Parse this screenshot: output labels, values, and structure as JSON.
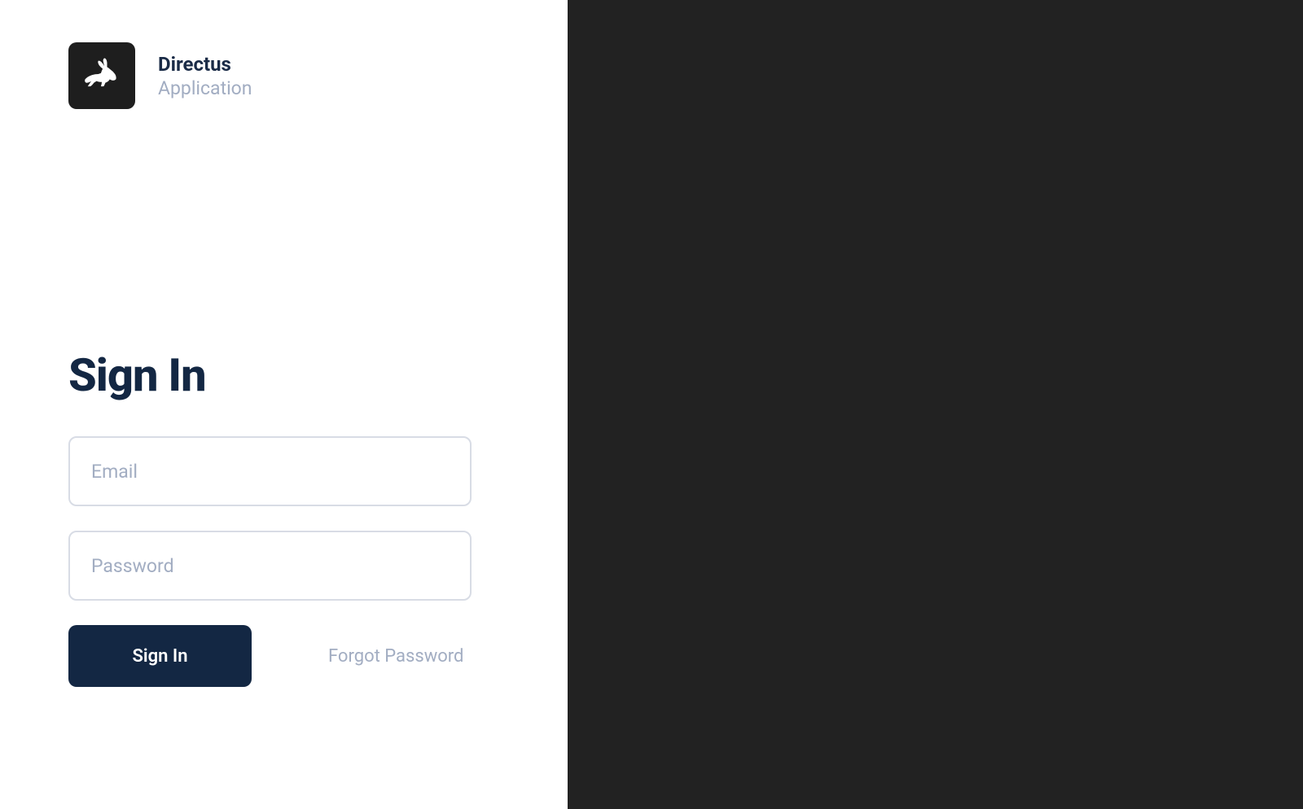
{
  "brand": {
    "title": "Directus",
    "subtitle": "Application"
  },
  "page": {
    "title": "Sign In"
  },
  "form": {
    "email_placeholder": "Email",
    "password_placeholder": "Password",
    "signin_button": "Sign In",
    "forgot_link": "Forgot Password"
  }
}
